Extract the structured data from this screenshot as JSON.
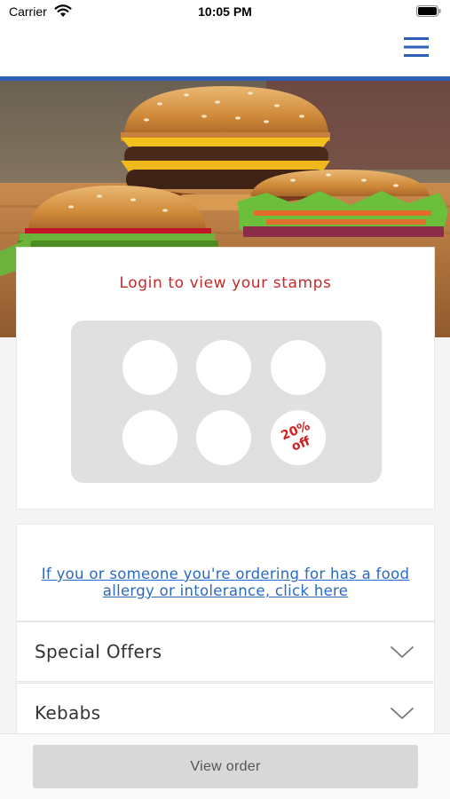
{
  "status_bar": {
    "carrier": "Carrier",
    "time": "10:05 PM",
    "wifi_icon": "wifi-icon",
    "battery_icon": "battery-icon"
  },
  "header": {
    "menu_icon": "hamburger-menu-icon",
    "accent_color": "#2d5fb4"
  },
  "hero": {
    "image": "burgers-photo"
  },
  "stamp_card": {
    "title": "Login to view your stamps",
    "title_color": "#c52a2a",
    "stamps_total": 6,
    "reward_line1": "20%",
    "reward_line2": "off"
  },
  "allergy_notice": {
    "link_text": "If you or someone you're ordering for has a food allergy or intolerance, click here",
    "link_color": "#2a6ac2"
  },
  "menu_categories": [
    {
      "label": "Special Offers",
      "icon": "chevron-down-icon"
    },
    {
      "label": "Kebabs",
      "icon": "chevron-down-icon"
    }
  ],
  "bottom_bar": {
    "button_label": "View order"
  }
}
